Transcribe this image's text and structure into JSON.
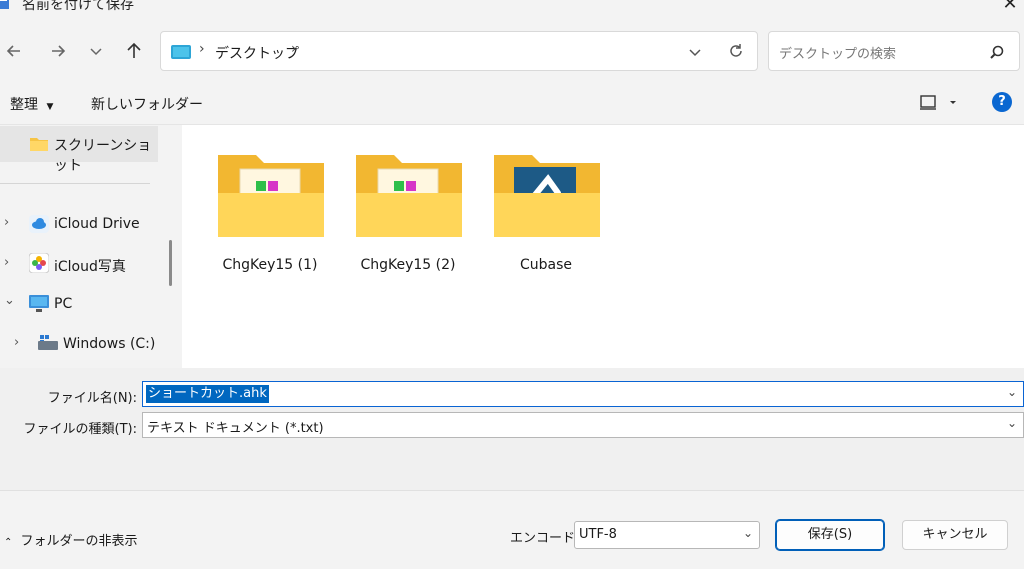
{
  "window": {
    "title": "名前を付けて保存",
    "close_glyph": "✕"
  },
  "address": {
    "location": "デスクトップ",
    "search_placeholder": "デスクトップの検索"
  },
  "toolbar": {
    "organize_label": "整理",
    "new_folder_label": "新しいフォルダー"
  },
  "nav": {
    "items": [
      {
        "label": "スクリーンショット",
        "selected": true
      },
      {
        "label": "iCloud Drive"
      },
      {
        "label": "iCloud写真"
      },
      {
        "label": "PC"
      },
      {
        "label": "Windows (C:)"
      }
    ]
  },
  "folders": [
    {
      "label": "ChgKey15 (1)",
      "icon": "folder-with-app-icon"
    },
    {
      "label": "ChgKey15 (2)",
      "icon": "folder-with-app-icon"
    },
    {
      "label": "Cubase",
      "icon": "folder-cubase-icon"
    }
  ],
  "form": {
    "filename_label": "ファイル名(N):",
    "filename_value": "ショートカット.ahk",
    "filetype_label": "ファイルの種類(T):",
    "filetype_value": "テキスト ドキュメント (*.txt)"
  },
  "footer": {
    "hide_folders_label": "フォルダーの非表示",
    "encoding_label": "エンコード:",
    "encoding_value": "UTF-8",
    "save_label": "保存(S)",
    "cancel_label": "キャンセル"
  },
  "colors": {
    "accent": "#0067c0",
    "folder": "#f8c93a",
    "help": "#0a67d1"
  }
}
